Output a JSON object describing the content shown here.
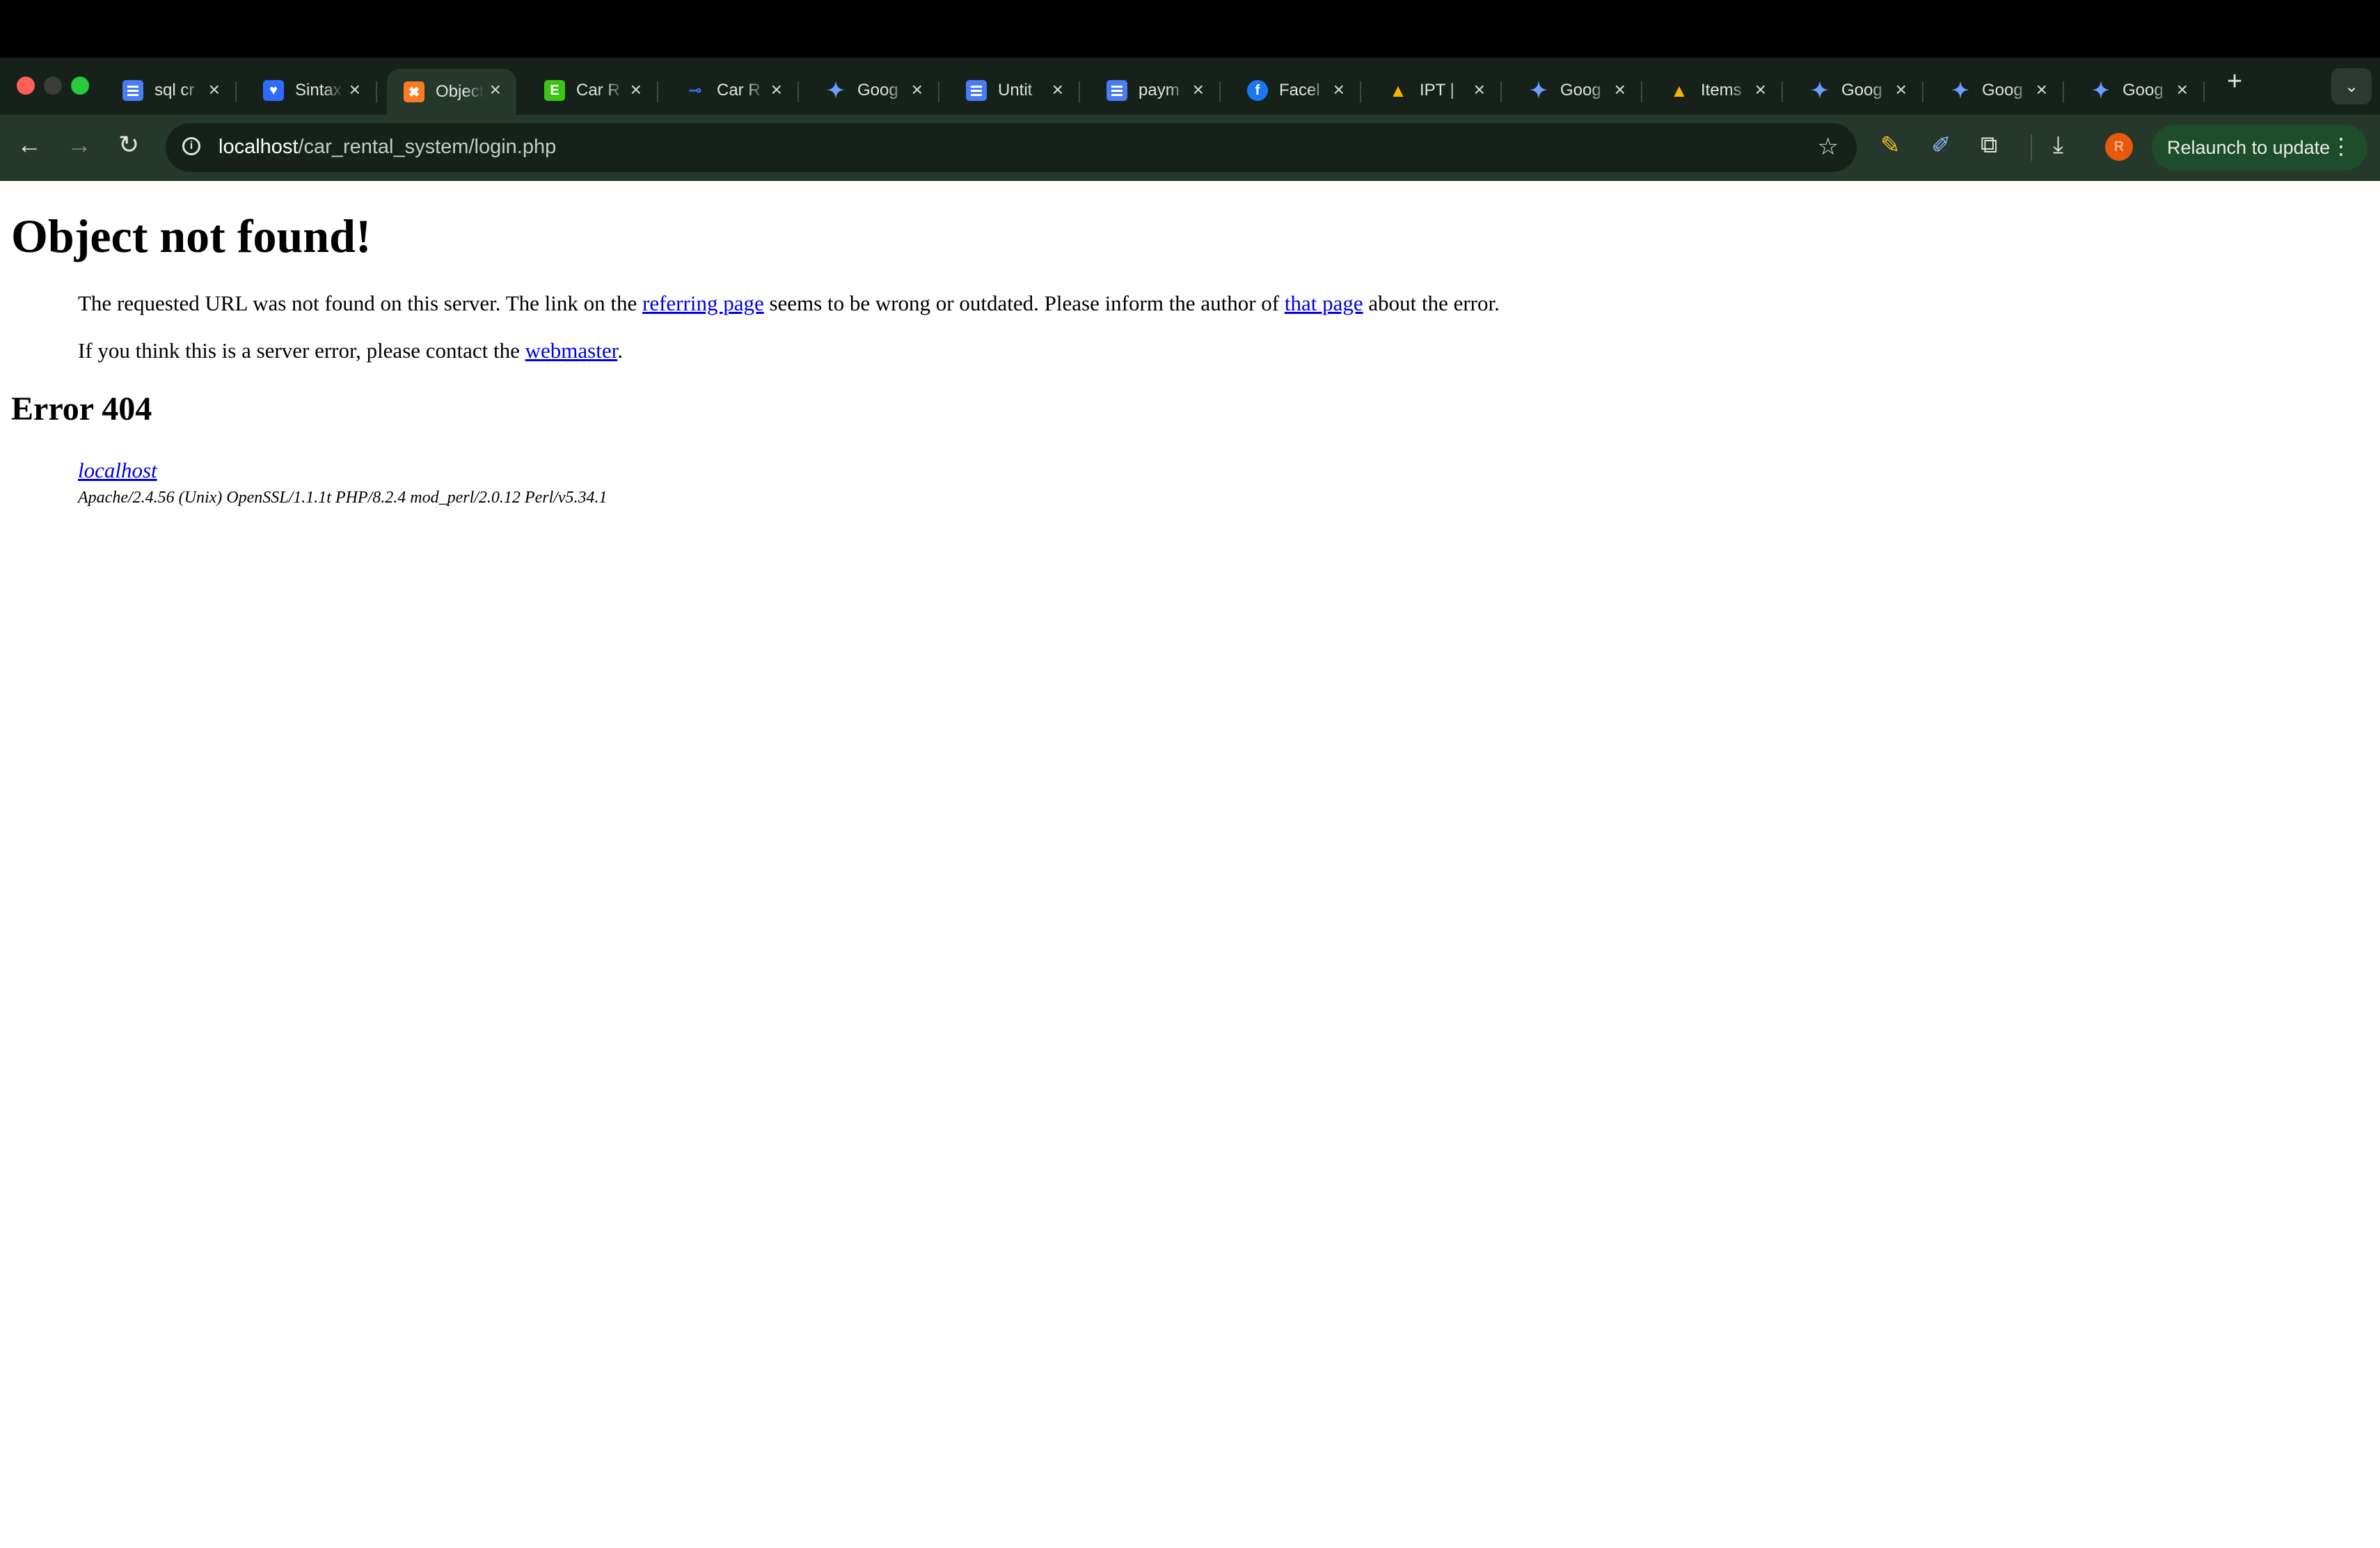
{
  "browser": {
    "tabs": [
      {
        "label": "sql cr",
        "icon": "docs-icon"
      },
      {
        "label": "Sintax",
        "icon": "heart-icon"
      },
      {
        "label": "Object",
        "icon": "xampp-icon",
        "active": true
      },
      {
        "label": "Car R",
        "icon": "e-icon"
      },
      {
        "label": "Car R",
        "icon": "car-icon"
      },
      {
        "label": "Goog",
        "icon": "gemini-icon"
      },
      {
        "label": "Untit",
        "icon": "docs-icon"
      },
      {
        "label": "paym",
        "icon": "docs-icon"
      },
      {
        "label": "Facel",
        "icon": "facebook-icon"
      },
      {
        "label": "IPT | ",
        "icon": "drive-icon"
      },
      {
        "label": "Goog",
        "icon": "gemini-icon"
      },
      {
        "label": "Items",
        "icon": "drive-icon"
      },
      {
        "label": "Goog",
        "icon": "gemini-icon"
      },
      {
        "label": "Goog",
        "icon": "gemini-icon"
      },
      {
        "label": "Goog",
        "icon": "gemini-icon"
      }
    ],
    "address": {
      "host": "localhost",
      "path": "/car_rental_system/login.php"
    },
    "profile_initial": "R",
    "relaunch_label": "Relaunch to update"
  },
  "page": {
    "title": "Object not found!",
    "msg1_a": "The requested URL was not found on this server. The link on the ",
    "msg1_link1": "referring page",
    "msg1_b": " seems to be wrong or outdated. Please inform the author of ",
    "msg1_link2": "that page",
    "msg1_c": " about the error.",
    "msg2_a": "If you think this is a server error, please contact the ",
    "msg2_link": "webmaster",
    "msg2_b": ".",
    "error_heading": "Error 404",
    "host_link": "localhost",
    "signature": "Apache/2.4.56 (Unix) OpenSSL/1.1.1t PHP/8.2.4 mod_perl/2.0.12 Perl/v5.34.1"
  },
  "colors": {
    "link": "#0000ee",
    "tab_bg": "#16211a",
    "toolbar_bg": "#26372c"
  }
}
